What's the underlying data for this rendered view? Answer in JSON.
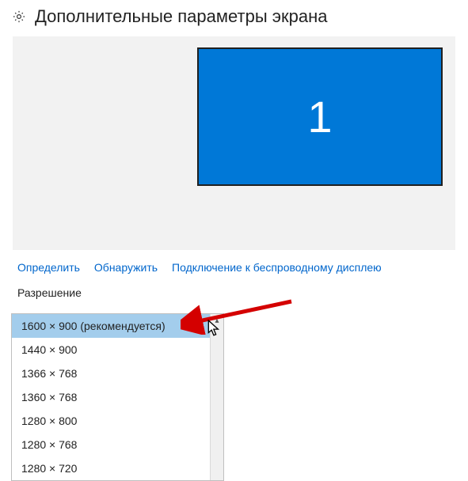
{
  "header": {
    "title": "Дополнительные параметры экрана"
  },
  "monitor": {
    "number": "1"
  },
  "links": {
    "identify": "Определить",
    "detect": "Обнаружить",
    "wireless": "Подключение к беспроводному дисплею"
  },
  "section": {
    "resolution_label": "Разрешение"
  },
  "resolution": {
    "options": [
      "1600 × 900 (рекомендуется)",
      "1440 × 900",
      "1366 × 768",
      "1360 × 768",
      "1280 × 800",
      "1280 × 768",
      "1280 × 720"
    ],
    "selected_index": 0
  },
  "colors": {
    "accent": "#0078d7",
    "link": "#0066cc",
    "panel": "#f2f2f2",
    "selection": "#a3cdec",
    "arrow": "#d40000"
  }
}
